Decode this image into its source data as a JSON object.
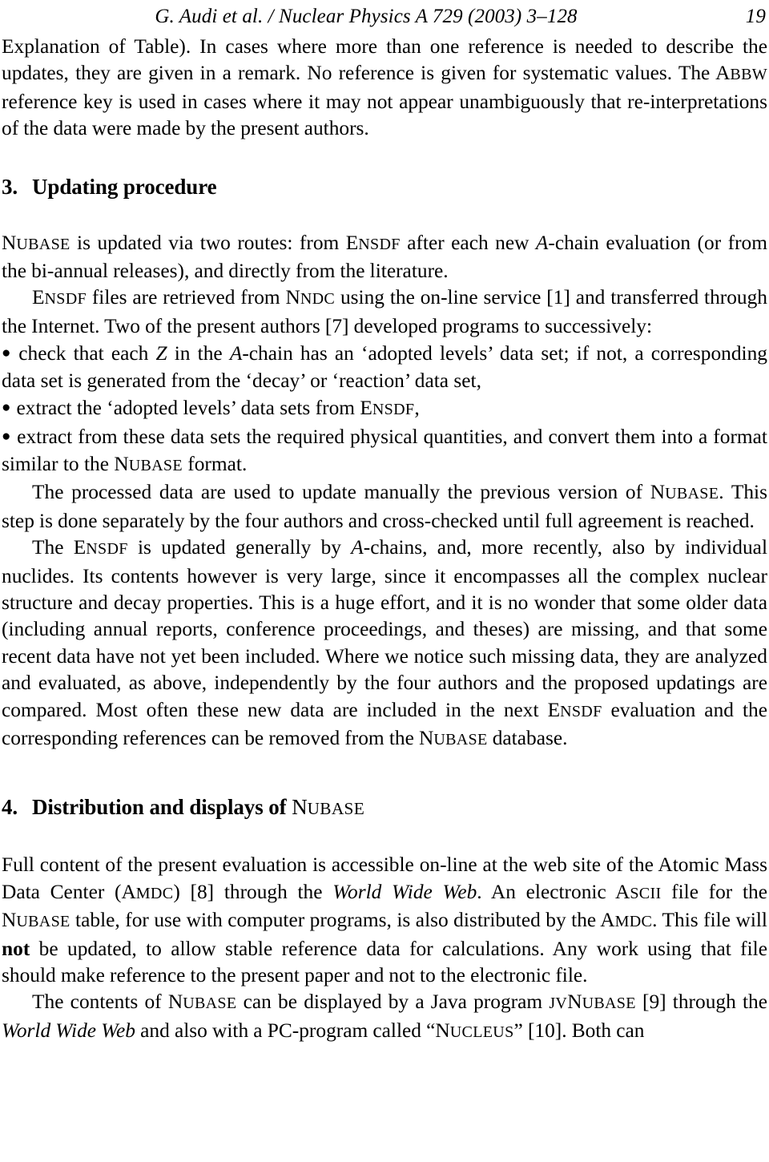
{
  "page": {
    "running_head": "G. Audi et al. / Nuclear Physics A 729 (2003) 3–128",
    "page_number": "19"
  },
  "paragraphs": {
    "p_explanation": {
      "s1": "Explanation of Table).  In cases where more than one reference is needed to describe the updates, they are given in a remark.  No reference is given for systematic values.  The ",
      "acronym1_first": "A",
      "acronym1_rest": "BBW",
      "s2": " reference key is used in cases where it may not appear unambiguously that re-interpretations of the data were made by the present authors."
    },
    "p_nubase_routes": {
      "acronym1_first": "N",
      "acronym1_rest": "UBASE",
      "s1": " is updated via two routes:  from ",
      "acronym2_first": "E",
      "acronym2_rest": "NSDF",
      "s2": " after each new ",
      "italic1": "A",
      "s3": "-chain evaluation (or from the bi-annual releases), and directly from the literature."
    },
    "p_ensdf_files": {
      "acronym1_first": "E",
      "acronym1_rest": "NSDF",
      "s1": " files are retrieved from ",
      "acronym2_first": "N",
      "acronym2_rest": "NDC",
      "s2": " using the on-line service [1] and transferred through the Internet.  Two of the present authors [7] developed programs to successively:"
    },
    "bullet1": {
      "mark": "●",
      "s1": "check that each ",
      "italic1": "Z",
      "s2": " in the ",
      "italic2": "A",
      "s3": "-chain has an ‘adopted levels’ data set; if not, a corresponding data set is generated from the ‘decay’ or ‘reaction’ data set,"
    },
    "bullet2": {
      "mark": "●",
      "s1": "extract the ‘adopted levels’ data sets from ",
      "acronym1_first": "E",
      "acronym1_rest": "NSDF",
      "s2": ","
    },
    "bullet3": {
      "mark": "●",
      "s1": "extract from these data sets the required physical quantities, and convert them into a format similar to the ",
      "acronym1_first": "N",
      "acronym1_rest": "UBASE",
      "s2": " format."
    },
    "p_processed": {
      "s1": "The processed data are used to update manually the previous version of ",
      "acronym1_first": "N",
      "acronym1_rest": "UBASE",
      "s2": ". This step is done separately by the four authors and cross-checked until full agreement is reached."
    },
    "p_ensdf_updated": {
      "s1": "The ",
      "acronym1_first": "E",
      "acronym1_rest": "NSDF",
      "s2": " is updated generally by ",
      "italic1": "A",
      "s3": "-chains, and, more recently, also by individual nuclides.  Its contents however is very large, since it encompasses all the complex nuclear structure and decay properties.  This is a huge effort, and it is no wonder that some older data (including annual reports, conference proceedings, and theses) are missing, and that some recent data have not yet been included.  Where we notice such missing data, they are analyzed and evaluated, as above, independently by the four authors and the proposed updatings are compared.  Most often these new data are included in the next ",
      "acronym2_first": "E",
      "acronym2_rest": "NSDF",
      "s4": " evaluation and the corresponding references can be removed from the ",
      "acronym3_first": "N",
      "acronym3_rest": "UBASE",
      "s5": " database."
    },
    "p_full_content": {
      "s1": "Full content of the present evaluation is accessible on-line at the web site of the Atomic Mass Data Center (",
      "acronym1_first": "A",
      "acronym1_rest": "MDC",
      "s2": ") [8] through the ",
      "italic1": "World Wide Web",
      "s3": ". An electronic ",
      "acronym2_first": "A",
      "acronym2_rest": "SCII",
      "s4": " file for the ",
      "acronym3_first": "N",
      "acronym3_rest": "UBASE",
      "s5": " table, for use with computer programs, is also distributed by the ",
      "acronym4_first": "A",
      "acronym4_rest": "MDC",
      "s6": ". This file will ",
      "bold1": "not",
      "s7": " be updated, to allow stable reference data for calculations. Any work using that file should make reference to the present paper and not to the electronic file."
    },
    "p_contents_display": {
      "s1": "The contents of ",
      "acronym1_first": "N",
      "acronym1_rest": "UBASE",
      "s2": " can be displayed by a Java program ",
      "acronym2_first": "JV",
      "acronym2_rest": "",
      "acronym3_first": "N",
      "acronym3_rest": "UBASE",
      "s3": " [9] through the ",
      "italic1": "World Wide Web",
      "s4": " and also with a PC-program called “",
      "acronym4_first": "N",
      "acronym4_rest": "UCLEUS",
      "s5": "” [10].  Both can"
    }
  },
  "headings": {
    "section3": {
      "number": "3.",
      "title": "Updating procedure"
    },
    "section4": {
      "number": "4.",
      "title": "Distribution and displays of ",
      "acronym_first": "N",
      "acronym_rest": "UBASE"
    }
  }
}
